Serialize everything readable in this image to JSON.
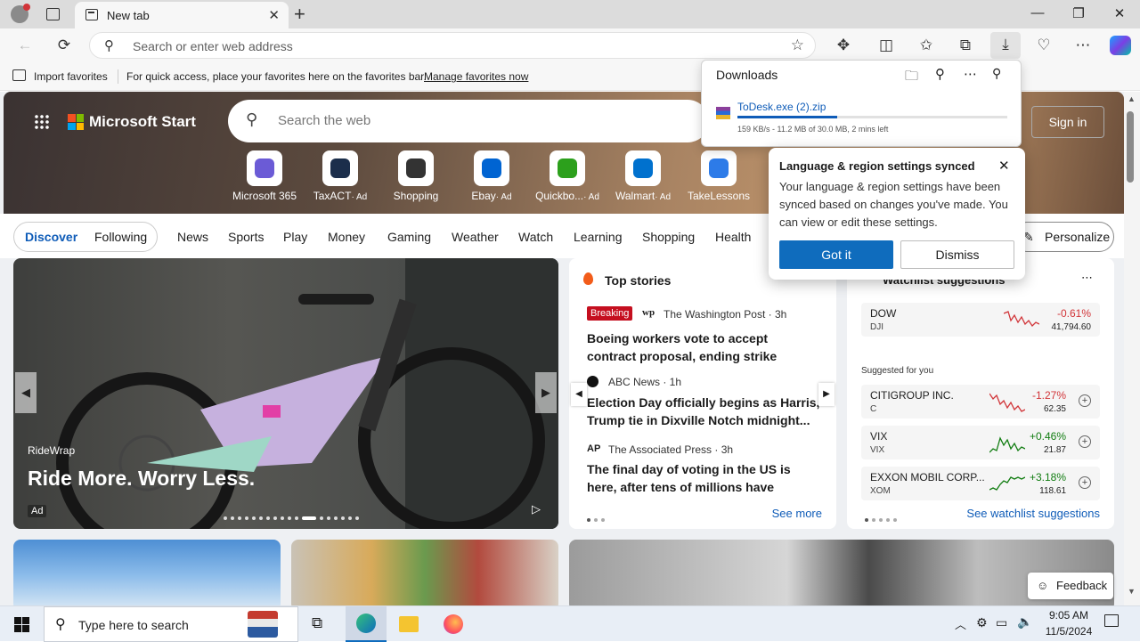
{
  "browser": {
    "tab_title": "New tab",
    "address_placeholder": "Search or enter web address"
  },
  "favorites_bar": {
    "import_label": "Import favorites",
    "hint_text": "For quick access, place your favorites here on the favorites bar.",
    "manage_link": "Manage favorites now"
  },
  "downloads": {
    "title": "Downloads",
    "file_name": "ToDesk.exe (2).zip",
    "status": "159 KB/s - 11.2 MB of 30.0 MB, 2 mins left",
    "progress": 0.37
  },
  "sync_popup": {
    "title": "Language & region settings synced",
    "body": "Your language & region settings have been synced based on changes you've made. You can view or edit these settings.",
    "primary_button": "Got it",
    "secondary_button": "Dismiss"
  },
  "msstart": {
    "brand": "Microsoft Start",
    "search_placeholder": "Search the web",
    "sign_in": "Sign in",
    "quick_links": [
      {
        "label": "Microsoft 365",
        "ad": "",
        "icon": "m365-icon"
      },
      {
        "label": "TaxACT",
        "ad": "· Ad",
        "icon": "taxact-icon"
      },
      {
        "label": "Shopping",
        "ad": "",
        "icon": "shopping-tag-icon"
      },
      {
        "label": "Ebay",
        "ad": "· Ad",
        "icon": "ebay-bag-icon"
      },
      {
        "label": "Quickbo...",
        "ad": "· Ad",
        "icon": "quickbooks-icon"
      },
      {
        "label": "Walmart",
        "ad": "· Ad",
        "icon": "walmart-icon"
      },
      {
        "label": "TakeLessons",
        "ad": "",
        "icon": "takelessons-icon"
      }
    ],
    "nav": {
      "discover": "Discover",
      "following": "Following",
      "items": [
        "News",
        "Sports",
        "Play",
        "Money",
        "Gaming",
        "Weather",
        "Watch",
        "Learning",
        "Shopping",
        "Health"
      ],
      "personalize": "Personalize"
    }
  },
  "hero_card": {
    "source": "RideWrap",
    "headline": "Ride More. Worry Less.",
    "ad_badge": "Ad"
  },
  "top_stories": {
    "title": "Top stories",
    "stories": [
      {
        "badge": "Breaking",
        "source": "The Washington Post · 3h",
        "headline": "Boeing workers vote to accept contract proposal, ending strike"
      },
      {
        "badge": "",
        "source": "ABC News · 1h",
        "headline": "Election Day officially begins as Harris, Trump tie in Dixville Notch midnight..."
      },
      {
        "badge": "",
        "source": "The Associated Press · 3h",
        "headline": "The final day of voting in the US is here, after tens of millions have already cast..."
      }
    ],
    "see_more": "See more"
  },
  "watchlist": {
    "title": "Watchlist suggestions",
    "index": {
      "name": "DOW",
      "symbol": "DJI",
      "change": "-0.61%",
      "price": "41,794.60"
    },
    "suggested_label": "Suggested for you",
    "stocks": [
      {
        "name": "CITIGROUP INC.",
        "symbol": "C",
        "change": "-1.27%",
        "price": "62.35",
        "color": "#d13438"
      },
      {
        "name": "VIX",
        "symbol": "VIX",
        "change": "+0.46%",
        "price": "21.87",
        "color": "#107c10"
      },
      {
        "name": "EXXON MOBIL CORP...",
        "symbol": "XOM",
        "change": "+3.18%",
        "price": "118.61",
        "color": "#107c10"
      }
    ],
    "see_link": "See watchlist suggestions"
  },
  "feedback": "Feedback",
  "taskbar": {
    "search_placeholder": "Type here to search",
    "time": "9:05 AM",
    "date": "11/5/2024"
  }
}
